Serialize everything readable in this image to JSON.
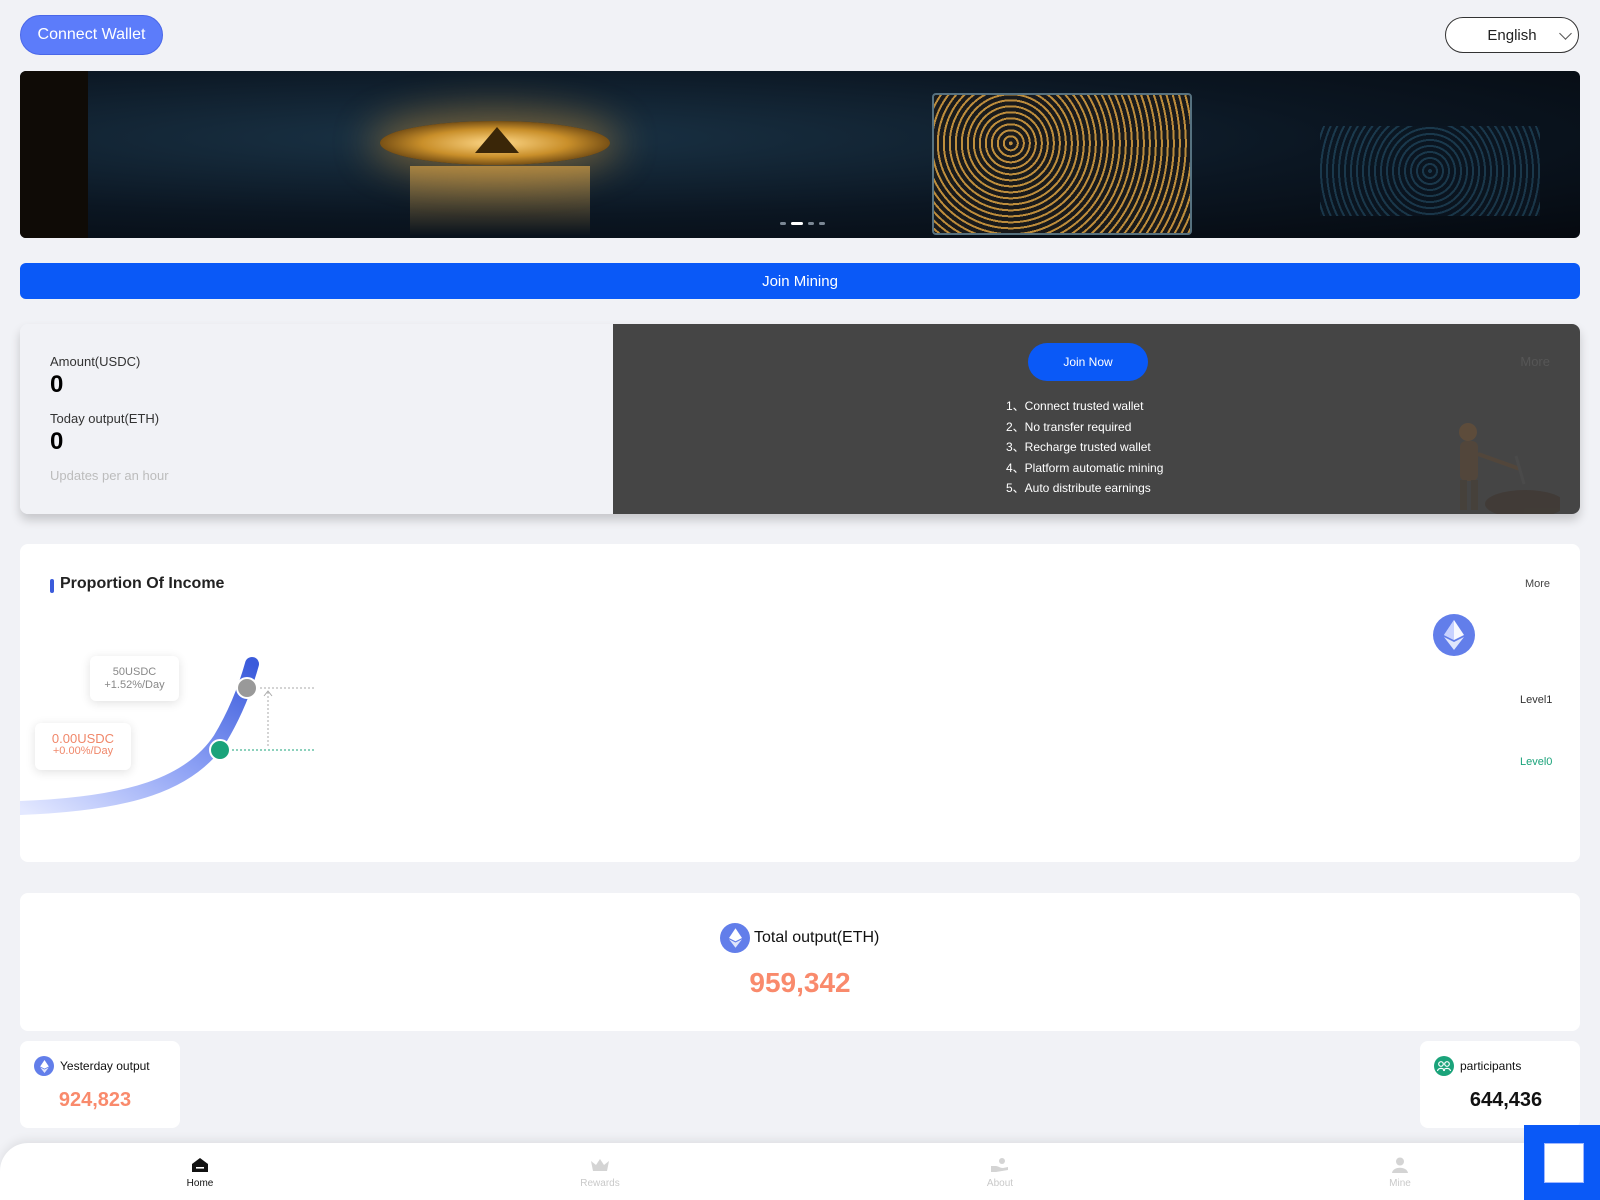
{
  "header": {
    "connect_wallet": "Connect Wallet",
    "language": "English"
  },
  "join_mining": "Join Mining",
  "amount_card": {
    "amount_label": "Amount(USDC)",
    "amount_value": "0",
    "today_label": "Today output(ETH)",
    "today_value": "0",
    "note": "Updates per an hour",
    "join_now": "Join Now",
    "more": "More",
    "steps": [
      "1、Connect trusted wallet",
      "2、No transfer required",
      "3、Recharge trusted wallet",
      "4、Platform automatic mining",
      "5、Auto distribute earnings"
    ]
  },
  "income": {
    "title": "Proportion Of Income",
    "more": "More",
    "levels": [
      "Level1",
      "Level0"
    ],
    "tip_top": {
      "amount": "50USDC",
      "rate": "+1.52%/Day"
    },
    "tip_bottom": {
      "amount": "0.00USDC",
      "rate": "+0.00%/Day"
    }
  },
  "total": {
    "label": "Total output(ETH)",
    "value": "959,342"
  },
  "yesterday": {
    "label": "Yesterday output",
    "value": "924,823"
  },
  "participants": {
    "label": "participants",
    "value": "644,436"
  },
  "nav": [
    {
      "label": "Home",
      "icon": "home-icon"
    },
    {
      "label": "Rewards",
      "icon": "crown-icon"
    },
    {
      "label": "About",
      "icon": "hand-icon"
    },
    {
      "label": "Mine",
      "icon": "user-icon"
    }
  ],
  "colors": {
    "primary": "#0a59f7",
    "accent": "#f98a6c",
    "eth": "#627eea",
    "green": "#1aa37a"
  }
}
